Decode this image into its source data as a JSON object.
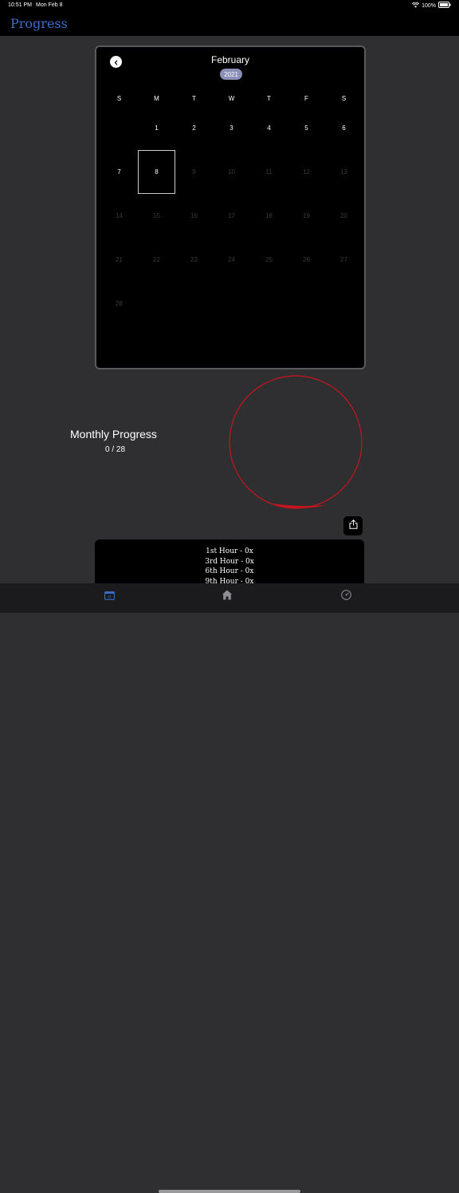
{
  "status_bar": {
    "time": "10:51 PM",
    "date": "Mon Feb 8",
    "battery": "100%"
  },
  "nav": {
    "title": "Progress"
  },
  "calendar": {
    "month": "February",
    "year": "2021",
    "weekdays": [
      "S",
      "M",
      "T",
      "W",
      "T",
      "F",
      "S"
    ],
    "first_weekday_index": 1,
    "days": [
      "1",
      "2",
      "3",
      "4",
      "5",
      "6",
      "7",
      "8",
      "9",
      "10",
      "11",
      "12",
      "13",
      "14",
      "15",
      "16",
      "17",
      "18",
      "19",
      "20",
      "21",
      "22",
      "23",
      "24",
      "25",
      "26",
      "27",
      "28"
    ],
    "active_through": 8,
    "today": "8"
  },
  "monthly_progress": {
    "label": "Monthly Progress",
    "value": "0 / 28",
    "fraction": 0
  },
  "hours": [
    "1st Hour - 0x",
    "3rd Hour - 0x",
    "6th Hour - 0x",
    "9th Hour - 0x"
  ],
  "colors": {
    "accent_blue": "#3b6fc6",
    "ring_red": "#c8141e",
    "year_pill": "#8a8fb8"
  },
  "icons": {
    "back": "chevron-left-icon",
    "share": "share-icon",
    "wifi": "wifi-icon",
    "battery": "battery-icon"
  },
  "tabs": [
    {
      "name": "calendar-tab",
      "icon": "calendar-icon",
      "active": true
    },
    {
      "name": "home-tab",
      "icon": "house-icon",
      "active": false
    },
    {
      "name": "settings-tab",
      "icon": "gauge-icon",
      "active": false
    }
  ]
}
